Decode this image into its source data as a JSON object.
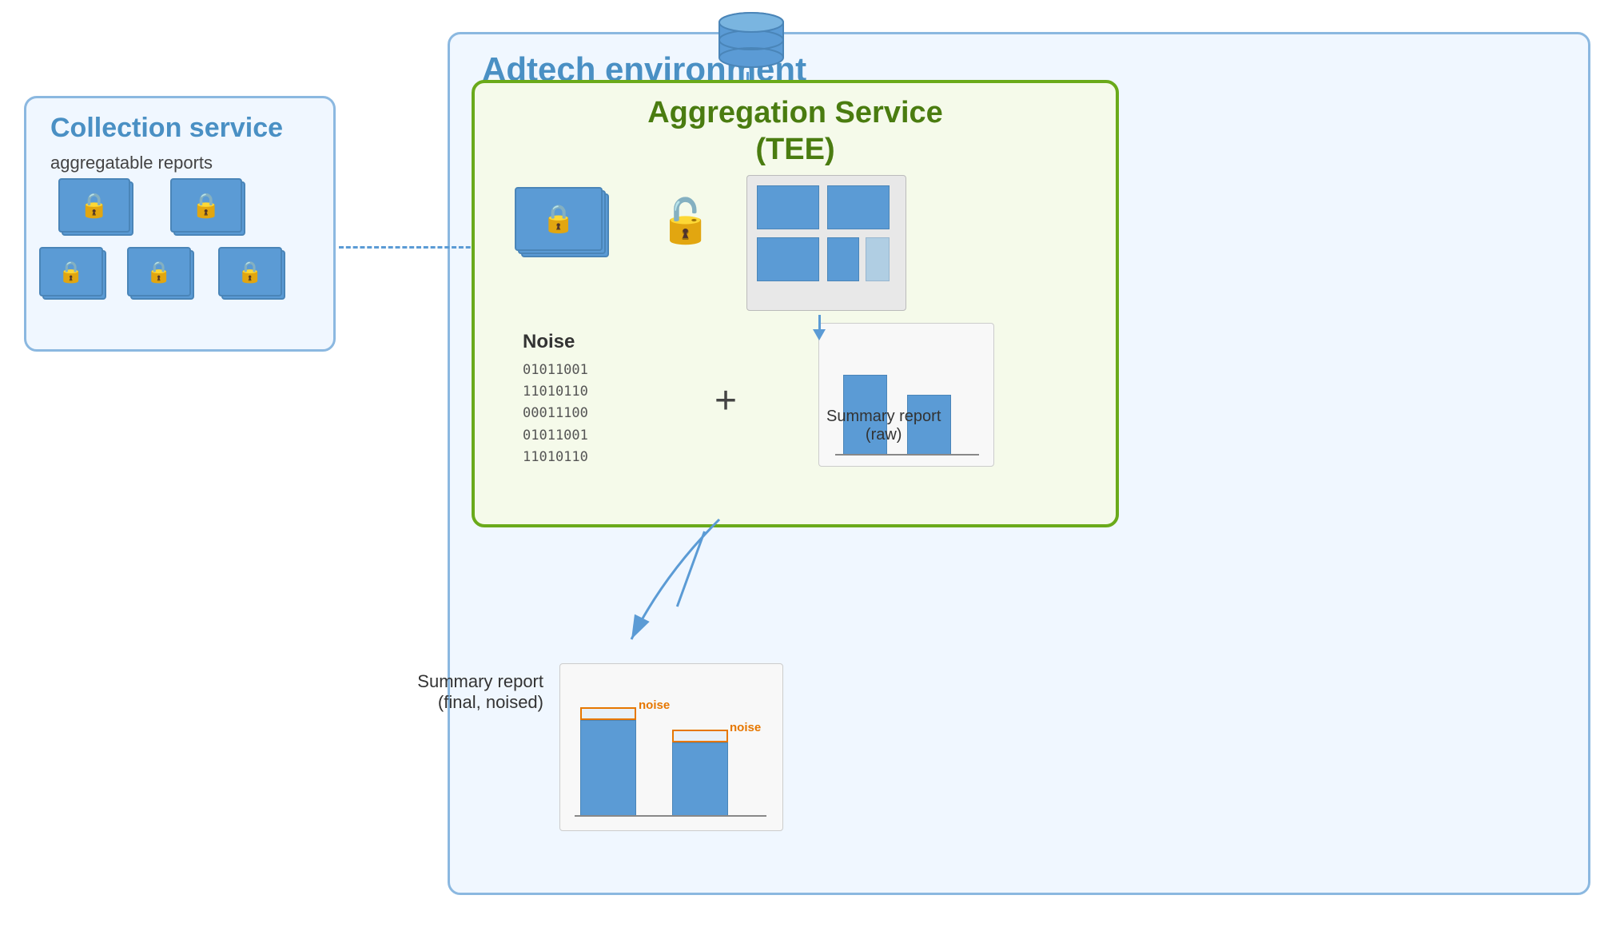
{
  "adtech": {
    "title": "Adtech environment"
  },
  "collection_service": {
    "title": "Collection service",
    "subtitle": "aggregatable reports"
  },
  "aggregation_service": {
    "title": "Aggregation Service",
    "tee": "(TEE)"
  },
  "noise": {
    "label": "Noise",
    "binary_lines": [
      "01011001",
      "11010110",
      "00011100",
      "01011001",
      "11010110"
    ]
  },
  "summary_reports": {
    "raw_label": "Summary report",
    "raw_sub": "(raw)",
    "final_label": "Summary report",
    "final_sub": "(final, noised)"
  },
  "noise_annotations": {
    "noise1": "noise",
    "noise2": "noise"
  }
}
